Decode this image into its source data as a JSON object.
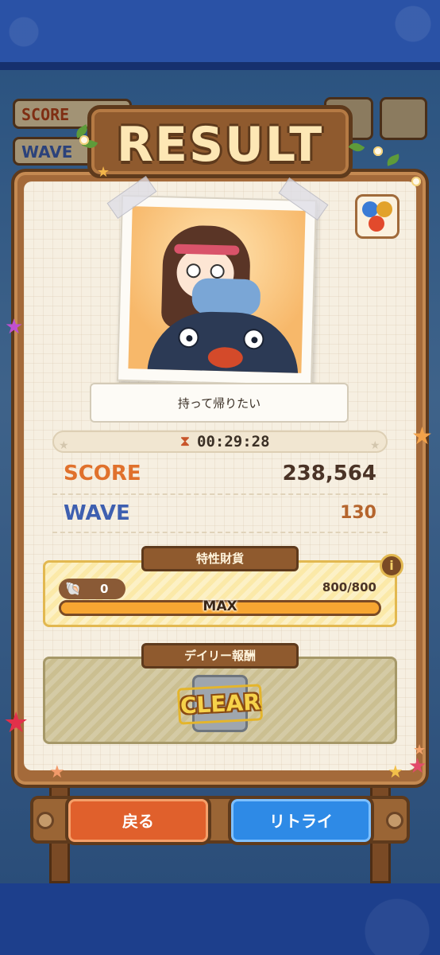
{
  "background_hud": {
    "score_label": "SCORE",
    "wave_label": "WAVE"
  },
  "title": "RESULT",
  "photo": {
    "caption": "持って帰りたい"
  },
  "result": {
    "time": "00:29:28",
    "score_label": "SCORE",
    "score_value": "238,564",
    "wave_label": "WAVE",
    "wave_value": "130"
  },
  "trait_currency": {
    "title": "特性財貨",
    "shell_count": "0",
    "progress_text": "800/800",
    "progress_fraction": 1.0,
    "gauge_label": "MAX"
  },
  "daily_reward": {
    "title": "デイリー報酬",
    "stamp": "CLEAR"
  },
  "buttons": {
    "back": "戻る",
    "retry": "リトライ"
  },
  "colors": {
    "score_label": "#e0712c",
    "wave_label": "#3e5fb0",
    "back_button": "#e0602c",
    "retry_button": "#2e8ae6",
    "gauge_fill": "#f7a632"
  },
  "icons": [
    "hourglass-icon",
    "shell-icon",
    "info-icon",
    "item-orbs-icon",
    "starfish-icon"
  ]
}
